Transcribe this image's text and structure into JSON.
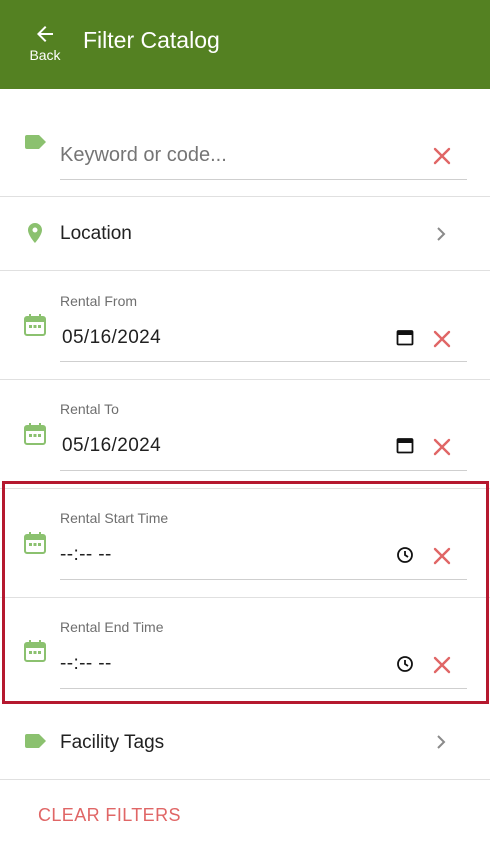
{
  "header": {
    "title": "Filter Catalog",
    "back_label": "Back",
    "background": "#548122"
  },
  "keyword": {
    "placeholder": "Keyword or code..."
  },
  "location": {
    "label": "Location"
  },
  "rental_from": {
    "label": "Rental From",
    "value": "05/16/2024"
  },
  "rental_to": {
    "label": "Rental To",
    "value": "05/16/2024"
  },
  "rental_start_time": {
    "label": "Rental Start Time",
    "value": "--:-- --"
  },
  "rental_end_time": {
    "label": "Rental End Time",
    "value": "--:-- --"
  },
  "facility_tags": {
    "label": "Facility Tags"
  },
  "clear_filters_label": "CLEAR FILTERS",
  "colors": {
    "icon_green": "#8bc16f",
    "clear_red": "#e06666",
    "highlight_border": "#b5182f"
  },
  "icons": {
    "back": "arrow-left-icon",
    "keyword": "tag-icon",
    "location": "map-pin-icon",
    "dates": "calendar-icon",
    "time": "clock-icon",
    "clear": "close-icon",
    "nav": "chevron-right-icon"
  }
}
